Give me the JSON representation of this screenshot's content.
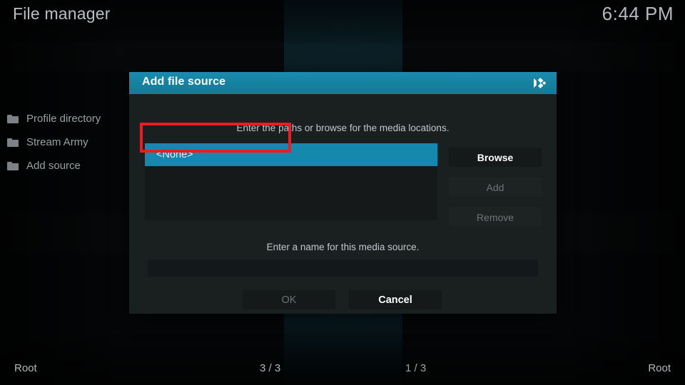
{
  "app": {
    "title": "File manager",
    "clock": "6:44 PM"
  },
  "file_list": {
    "items": [
      {
        "label": "Profile directory",
        "icon": "folder-icon"
      },
      {
        "label": "Stream Army",
        "icon": "folder-icon"
      },
      {
        "label": "Add source",
        "icon": "folder-icon"
      }
    ]
  },
  "statusbar": {
    "left_label": "Root",
    "left_count": "3 / 3",
    "right_count": "1 / 3",
    "right_label": "Root"
  },
  "dialog": {
    "title": "Add file source",
    "logo_icon": "kodi-logo-icon",
    "hint_paths": "Enter the paths or browse for the media locations.",
    "hint_name": "Enter a name for this media source.",
    "path_list": {
      "selected_value": "<None>"
    },
    "name_input": {
      "value": "",
      "placeholder": ""
    },
    "side_buttons": [
      {
        "label": "Browse",
        "enabled": true
      },
      {
        "label": "Add",
        "enabled": false
      },
      {
        "label": "Remove",
        "enabled": false
      }
    ],
    "action_buttons": [
      {
        "label": "OK",
        "enabled": false
      },
      {
        "label": "Cancel",
        "enabled": true
      }
    ]
  },
  "colors": {
    "accent_teal": "#1788ad",
    "header_teal": "#15819f",
    "annotation_red": "#ed1c24",
    "dialog_bg": "#1a1f20",
    "screen_bg": "#040607"
  }
}
